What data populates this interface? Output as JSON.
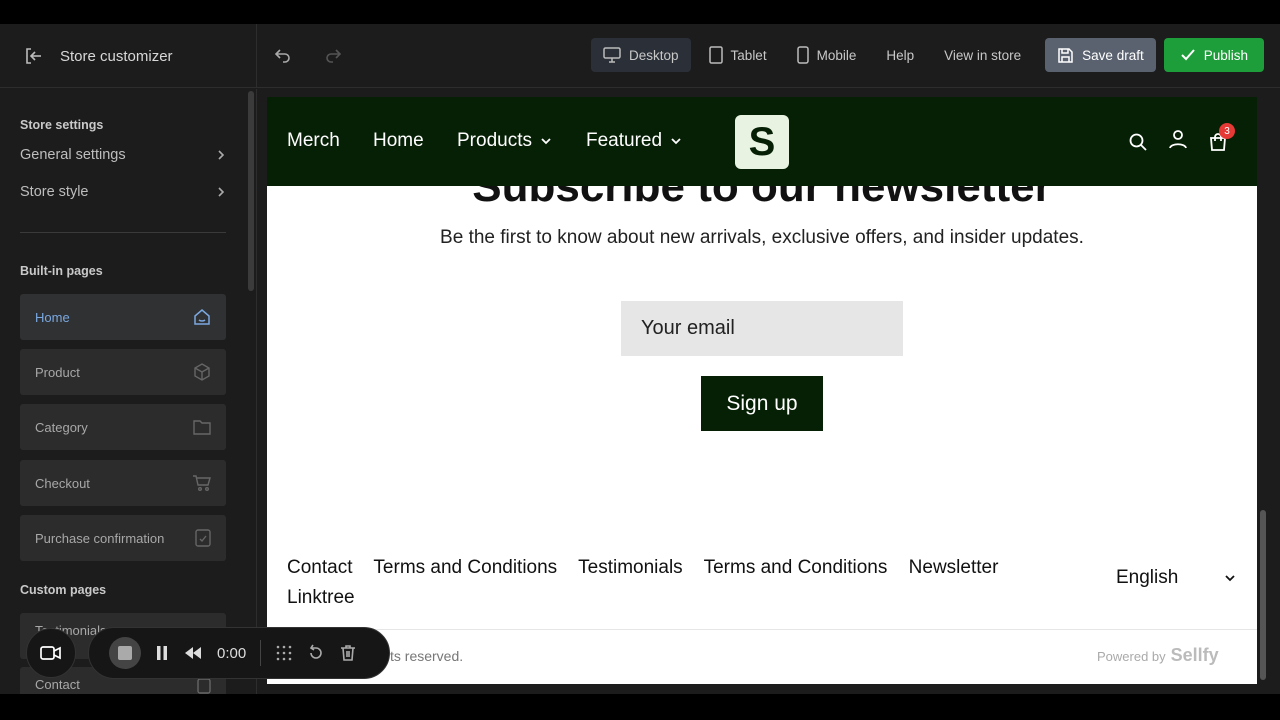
{
  "topbar": {
    "title": "Store customizer",
    "views": [
      "Desktop",
      "Tablet",
      "Mobile"
    ],
    "help": "Help",
    "view_in_store": "View in store",
    "save_draft": "Save draft",
    "publish": "Publish",
    "active_view": "Desktop"
  },
  "sidebar": {
    "store_settings_title": "Store settings",
    "general_settings": "General settings",
    "store_style": "Store style",
    "builtin_title": "Built-in pages",
    "builtin_pages": [
      "Home",
      "Product",
      "Category",
      "Checkout",
      "Purchase confirmation"
    ],
    "custom_title": "Custom pages",
    "custom_pages": [
      "Testimonials",
      "Contact"
    ]
  },
  "preview": {
    "nav": {
      "links": [
        "Merch",
        "Home",
        "Products",
        "Featured"
      ],
      "logo_letter": "S",
      "cart_count": "3"
    },
    "newsletter": {
      "title": "Subscribe to our newsletter",
      "subtitle": "Be the first to know about new arrivals, exclusive offers, and insider updates.",
      "email_placeholder": "Your email",
      "signup": "Sign up"
    },
    "footer": {
      "links": [
        "Contact",
        "Terms and Conditions",
        "Testimonials",
        "Terms and Conditions",
        "Newsletter",
        "Linktree"
      ],
      "language": "English",
      "copyright": "ts reserved.",
      "powered_by": "Powered by",
      "brand": "Sellfy"
    }
  },
  "recorder": {
    "time": "0:00"
  },
  "colors": {
    "accent_green": "#1e9e3a",
    "store_dark_green": "#062006",
    "active_blue": "#7aa8e0",
    "badge_red": "#e53935"
  }
}
